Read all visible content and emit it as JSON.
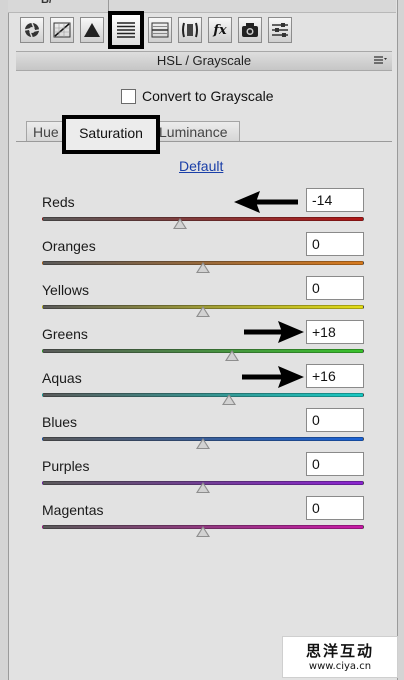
{
  "header": {
    "title": "HSL / Grayscale",
    "top_fragment": "B/"
  },
  "toolbar": {
    "icons": [
      "aperture-icon",
      "tone-curve-icon",
      "detail-triangle-icon",
      "hsl-bars-icon",
      "split-toning-icon",
      "lens-corrections-icon",
      "fx-icon",
      "camera-calibration-icon",
      "presets-sliders-icon"
    ],
    "selected": "hsl-bars-icon"
  },
  "convert": {
    "label": "Convert to Grayscale",
    "checked": false
  },
  "tabs": [
    {
      "label": "Hue",
      "selected": false
    },
    {
      "label": "Saturation",
      "selected": true
    },
    {
      "label": "Luminance",
      "selected": false
    }
  ],
  "default_link": "Default",
  "sliders": [
    {
      "label": "Reds",
      "value": "-14",
      "amount": -14,
      "colors": [
        "#5a5a5a",
        "#b01818"
      ]
    },
    {
      "label": "Oranges",
      "value": "0",
      "amount": 0,
      "colors": [
        "#5a5a5a",
        "#d77a1e"
      ]
    },
    {
      "label": "Yellows",
      "value": "0",
      "amount": 0,
      "colors": [
        "#5a5a5a",
        "#e3dd17"
      ]
    },
    {
      "label": "Greens",
      "value": "+18",
      "amount": 18,
      "colors": [
        "#5a5a5a",
        "#39c12c"
      ]
    },
    {
      "label": "Aquas",
      "value": "+16",
      "amount": 16,
      "colors": [
        "#5a5a5a",
        "#18c9c3"
      ]
    },
    {
      "label": "Blues",
      "value": "0",
      "amount": 0,
      "colors": [
        "#5a5a5a",
        "#1b63d6"
      ]
    },
    {
      "label": "Purples",
      "value": "0",
      "amount": 0,
      "colors": [
        "#5a5a5a",
        "#8a24d0"
      ]
    },
    {
      "label": "Magentas",
      "value": "0",
      "amount": 0,
      "colors": [
        "#5a5a5a",
        "#c81aa6"
      ]
    }
  ],
  "annotation_arrows": [
    "Reds",
    "Greens",
    "Aquas"
  ],
  "watermark": {
    "line1": "思洋互动",
    "line2": "www.ciya.cn"
  }
}
